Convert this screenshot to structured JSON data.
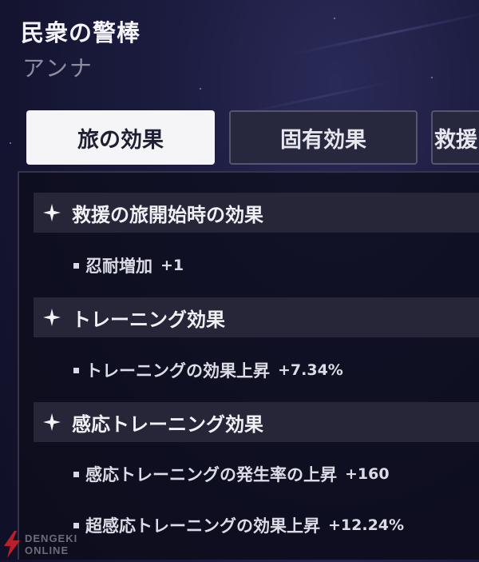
{
  "header": {
    "title": "民衆の警棒",
    "subtitle": "アンナ"
  },
  "tabs": [
    {
      "label": "旅の効果",
      "active": true
    },
    {
      "label": "固有効果",
      "active": false
    },
    {
      "label": "救援",
      "active": false
    }
  ],
  "sections": [
    {
      "title": "救援の旅開始時の効果",
      "effects": [
        {
          "label": "忍耐増加",
          "value": "+1"
        }
      ]
    },
    {
      "title": "トレーニング効果",
      "effects": [
        {
          "label": "トレーニングの効果上昇",
          "value": "+7.34%"
        }
      ]
    },
    {
      "title": "感応トレーニング効果",
      "effects": [
        {
          "label": "感応トレーニングの発生率の上昇",
          "value": "+160"
        },
        {
          "label": "超感応トレーニングの効果上昇",
          "value": "+12.24%"
        }
      ]
    }
  ],
  "icons": {
    "section": "sparkle-icon",
    "bullet": "square-bullet-icon",
    "watermark": "lightning-bolt-icon"
  },
  "watermark": {
    "line1": "DENGEKI",
    "line2": "ONLINE"
  },
  "colors": {
    "background": "#1a1a3a",
    "tab_active_bg": "#f5f5f7",
    "tab_inactive_bg": "#27273d",
    "section_header_bg": "#262638",
    "text_primary": "#f0f0f5",
    "text_muted": "#8c8ca0",
    "watermark_red": "#d8232a"
  }
}
